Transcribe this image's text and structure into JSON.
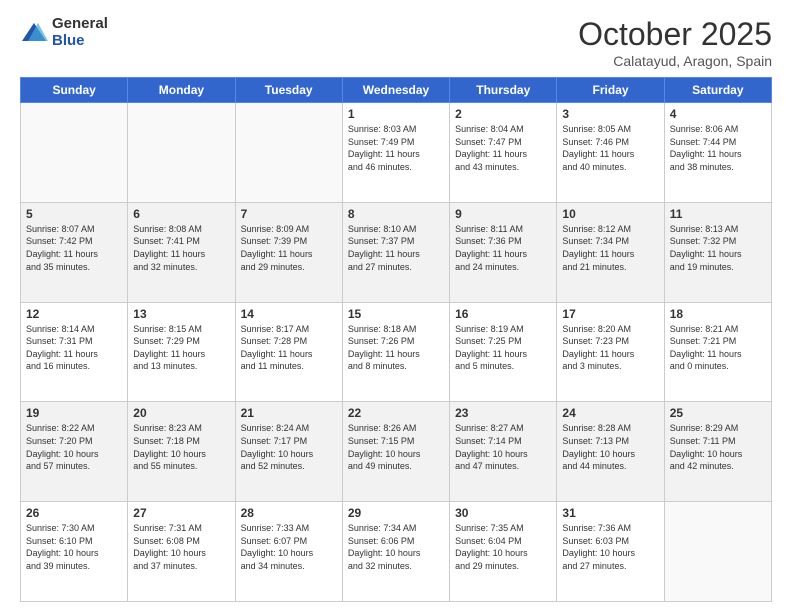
{
  "header": {
    "logo_general": "General",
    "logo_blue": "Blue",
    "month_title": "October 2025",
    "location": "Calatayud, Aragon, Spain"
  },
  "weekdays": [
    "Sunday",
    "Monday",
    "Tuesday",
    "Wednesday",
    "Thursday",
    "Friday",
    "Saturday"
  ],
  "weeks": [
    [
      {
        "day": "",
        "info": ""
      },
      {
        "day": "",
        "info": ""
      },
      {
        "day": "",
        "info": ""
      },
      {
        "day": "1",
        "info": "Sunrise: 8:03 AM\nSunset: 7:49 PM\nDaylight: 11 hours\nand 46 minutes."
      },
      {
        "day": "2",
        "info": "Sunrise: 8:04 AM\nSunset: 7:47 PM\nDaylight: 11 hours\nand 43 minutes."
      },
      {
        "day": "3",
        "info": "Sunrise: 8:05 AM\nSunset: 7:46 PM\nDaylight: 11 hours\nand 40 minutes."
      },
      {
        "day": "4",
        "info": "Sunrise: 8:06 AM\nSunset: 7:44 PM\nDaylight: 11 hours\nand 38 minutes."
      }
    ],
    [
      {
        "day": "5",
        "info": "Sunrise: 8:07 AM\nSunset: 7:42 PM\nDaylight: 11 hours\nand 35 minutes."
      },
      {
        "day": "6",
        "info": "Sunrise: 8:08 AM\nSunset: 7:41 PM\nDaylight: 11 hours\nand 32 minutes."
      },
      {
        "day": "7",
        "info": "Sunrise: 8:09 AM\nSunset: 7:39 PM\nDaylight: 11 hours\nand 29 minutes."
      },
      {
        "day": "8",
        "info": "Sunrise: 8:10 AM\nSunset: 7:37 PM\nDaylight: 11 hours\nand 27 minutes."
      },
      {
        "day": "9",
        "info": "Sunrise: 8:11 AM\nSunset: 7:36 PM\nDaylight: 11 hours\nand 24 minutes."
      },
      {
        "day": "10",
        "info": "Sunrise: 8:12 AM\nSunset: 7:34 PM\nDaylight: 11 hours\nand 21 minutes."
      },
      {
        "day": "11",
        "info": "Sunrise: 8:13 AM\nSunset: 7:32 PM\nDaylight: 11 hours\nand 19 minutes."
      }
    ],
    [
      {
        "day": "12",
        "info": "Sunrise: 8:14 AM\nSunset: 7:31 PM\nDaylight: 11 hours\nand 16 minutes."
      },
      {
        "day": "13",
        "info": "Sunrise: 8:15 AM\nSunset: 7:29 PM\nDaylight: 11 hours\nand 13 minutes."
      },
      {
        "day": "14",
        "info": "Sunrise: 8:17 AM\nSunset: 7:28 PM\nDaylight: 11 hours\nand 11 minutes."
      },
      {
        "day": "15",
        "info": "Sunrise: 8:18 AM\nSunset: 7:26 PM\nDaylight: 11 hours\nand 8 minutes."
      },
      {
        "day": "16",
        "info": "Sunrise: 8:19 AM\nSunset: 7:25 PM\nDaylight: 11 hours\nand 5 minutes."
      },
      {
        "day": "17",
        "info": "Sunrise: 8:20 AM\nSunset: 7:23 PM\nDaylight: 11 hours\nand 3 minutes."
      },
      {
        "day": "18",
        "info": "Sunrise: 8:21 AM\nSunset: 7:21 PM\nDaylight: 11 hours\nand 0 minutes."
      }
    ],
    [
      {
        "day": "19",
        "info": "Sunrise: 8:22 AM\nSunset: 7:20 PM\nDaylight: 10 hours\nand 57 minutes."
      },
      {
        "day": "20",
        "info": "Sunrise: 8:23 AM\nSunset: 7:18 PM\nDaylight: 10 hours\nand 55 minutes."
      },
      {
        "day": "21",
        "info": "Sunrise: 8:24 AM\nSunset: 7:17 PM\nDaylight: 10 hours\nand 52 minutes."
      },
      {
        "day": "22",
        "info": "Sunrise: 8:26 AM\nSunset: 7:15 PM\nDaylight: 10 hours\nand 49 minutes."
      },
      {
        "day": "23",
        "info": "Sunrise: 8:27 AM\nSunset: 7:14 PM\nDaylight: 10 hours\nand 47 minutes."
      },
      {
        "day": "24",
        "info": "Sunrise: 8:28 AM\nSunset: 7:13 PM\nDaylight: 10 hours\nand 44 minutes."
      },
      {
        "day": "25",
        "info": "Sunrise: 8:29 AM\nSunset: 7:11 PM\nDaylight: 10 hours\nand 42 minutes."
      }
    ],
    [
      {
        "day": "26",
        "info": "Sunrise: 7:30 AM\nSunset: 6:10 PM\nDaylight: 10 hours\nand 39 minutes."
      },
      {
        "day": "27",
        "info": "Sunrise: 7:31 AM\nSunset: 6:08 PM\nDaylight: 10 hours\nand 37 minutes."
      },
      {
        "day": "28",
        "info": "Sunrise: 7:33 AM\nSunset: 6:07 PM\nDaylight: 10 hours\nand 34 minutes."
      },
      {
        "day": "29",
        "info": "Sunrise: 7:34 AM\nSunset: 6:06 PM\nDaylight: 10 hours\nand 32 minutes."
      },
      {
        "day": "30",
        "info": "Sunrise: 7:35 AM\nSunset: 6:04 PM\nDaylight: 10 hours\nand 29 minutes."
      },
      {
        "day": "31",
        "info": "Sunrise: 7:36 AM\nSunset: 6:03 PM\nDaylight: 10 hours\nand 27 minutes."
      },
      {
        "day": "",
        "info": ""
      }
    ]
  ]
}
